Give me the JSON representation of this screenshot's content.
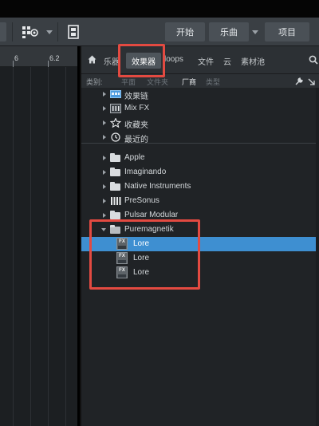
{
  "toolbar": {
    "start_label": "开始",
    "song_label": "乐曲",
    "project_label": "项目"
  },
  "ruler": {
    "marks": [
      "6",
      "6.2"
    ]
  },
  "browser": {
    "tabs": {
      "instruments": "乐器",
      "effects": "效果器",
      "loops": "loops",
      "files": "文件",
      "cloud": "云",
      "pool": "素材池"
    },
    "filter": {
      "label": "类别:",
      "category": "平面",
      "folder": "文件夹",
      "vendor": "厂商",
      "type": "类型"
    },
    "top_items": [
      {
        "label": "效果链",
        "icon": "fx-chain-icon"
      },
      {
        "label": "Mix FX",
        "icon": "mix-fx-icon"
      },
      {
        "label": "收藏夹",
        "icon": "star-icon"
      },
      {
        "label": "最近的",
        "icon": "clock-icon"
      }
    ],
    "vendors": [
      {
        "label": "Apple"
      },
      {
        "label": "Imaginando"
      },
      {
        "label": "Native Instruments"
      },
      {
        "label": "PreSonus"
      },
      {
        "label": "Pulsar Modular"
      },
      {
        "label": "Puremagnetik"
      }
    ],
    "plugins": [
      {
        "label": "Lore",
        "badge": "FX",
        "selected": true
      },
      {
        "label": "Lore",
        "badge": "FX",
        "selected": false
      },
      {
        "label": "Lore",
        "badge": "FX",
        "selected": false
      }
    ]
  },
  "colors": {
    "highlight": "#e34a41",
    "selection": "#3e8fd1"
  }
}
